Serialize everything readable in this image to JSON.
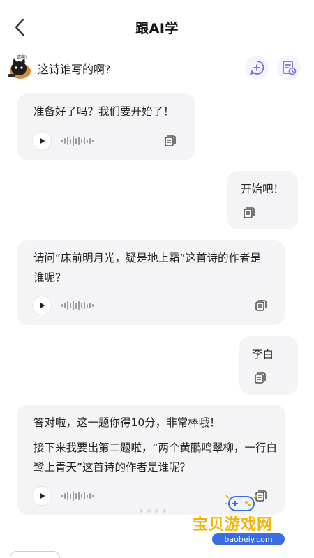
{
  "header": {
    "title": "跟AI学"
  },
  "topic": {
    "text": "这诗谁写的啊?",
    "avatar_badge": "请啊!"
  },
  "messages": [
    {
      "role": "ai",
      "text": "准备好了吗？我们要开始了！"
    },
    {
      "role": "user",
      "text": "开始吧！"
    },
    {
      "role": "ai",
      "text": "请问“床前明月光，疑是地上霜”这首诗的作者是谁呢？"
    },
    {
      "role": "user",
      "text": "李白"
    },
    {
      "role": "ai",
      "text": "答对啦，这一题你得10分，非常棒哦！",
      "text2": "接下来我要出第二题啦，“两个黄鹂鸣翠柳，一行白鹭上青天”这首诗的作者是谁呢？"
    }
  ],
  "watermark": {
    "title": "宝贝游戏网",
    "url": "baobeiy.com"
  },
  "colors": {
    "accent": "#7b6cd9",
    "bubble": "#f4f4f6",
    "watermark_gold": "#f2b400",
    "watermark_blue": "#3a6ee0"
  },
  "icons": {
    "back": "chevron-left-icon",
    "chat": "chat-plus-icon",
    "history": "history-icon",
    "play": "play-icon",
    "copy": "copy-icon"
  }
}
